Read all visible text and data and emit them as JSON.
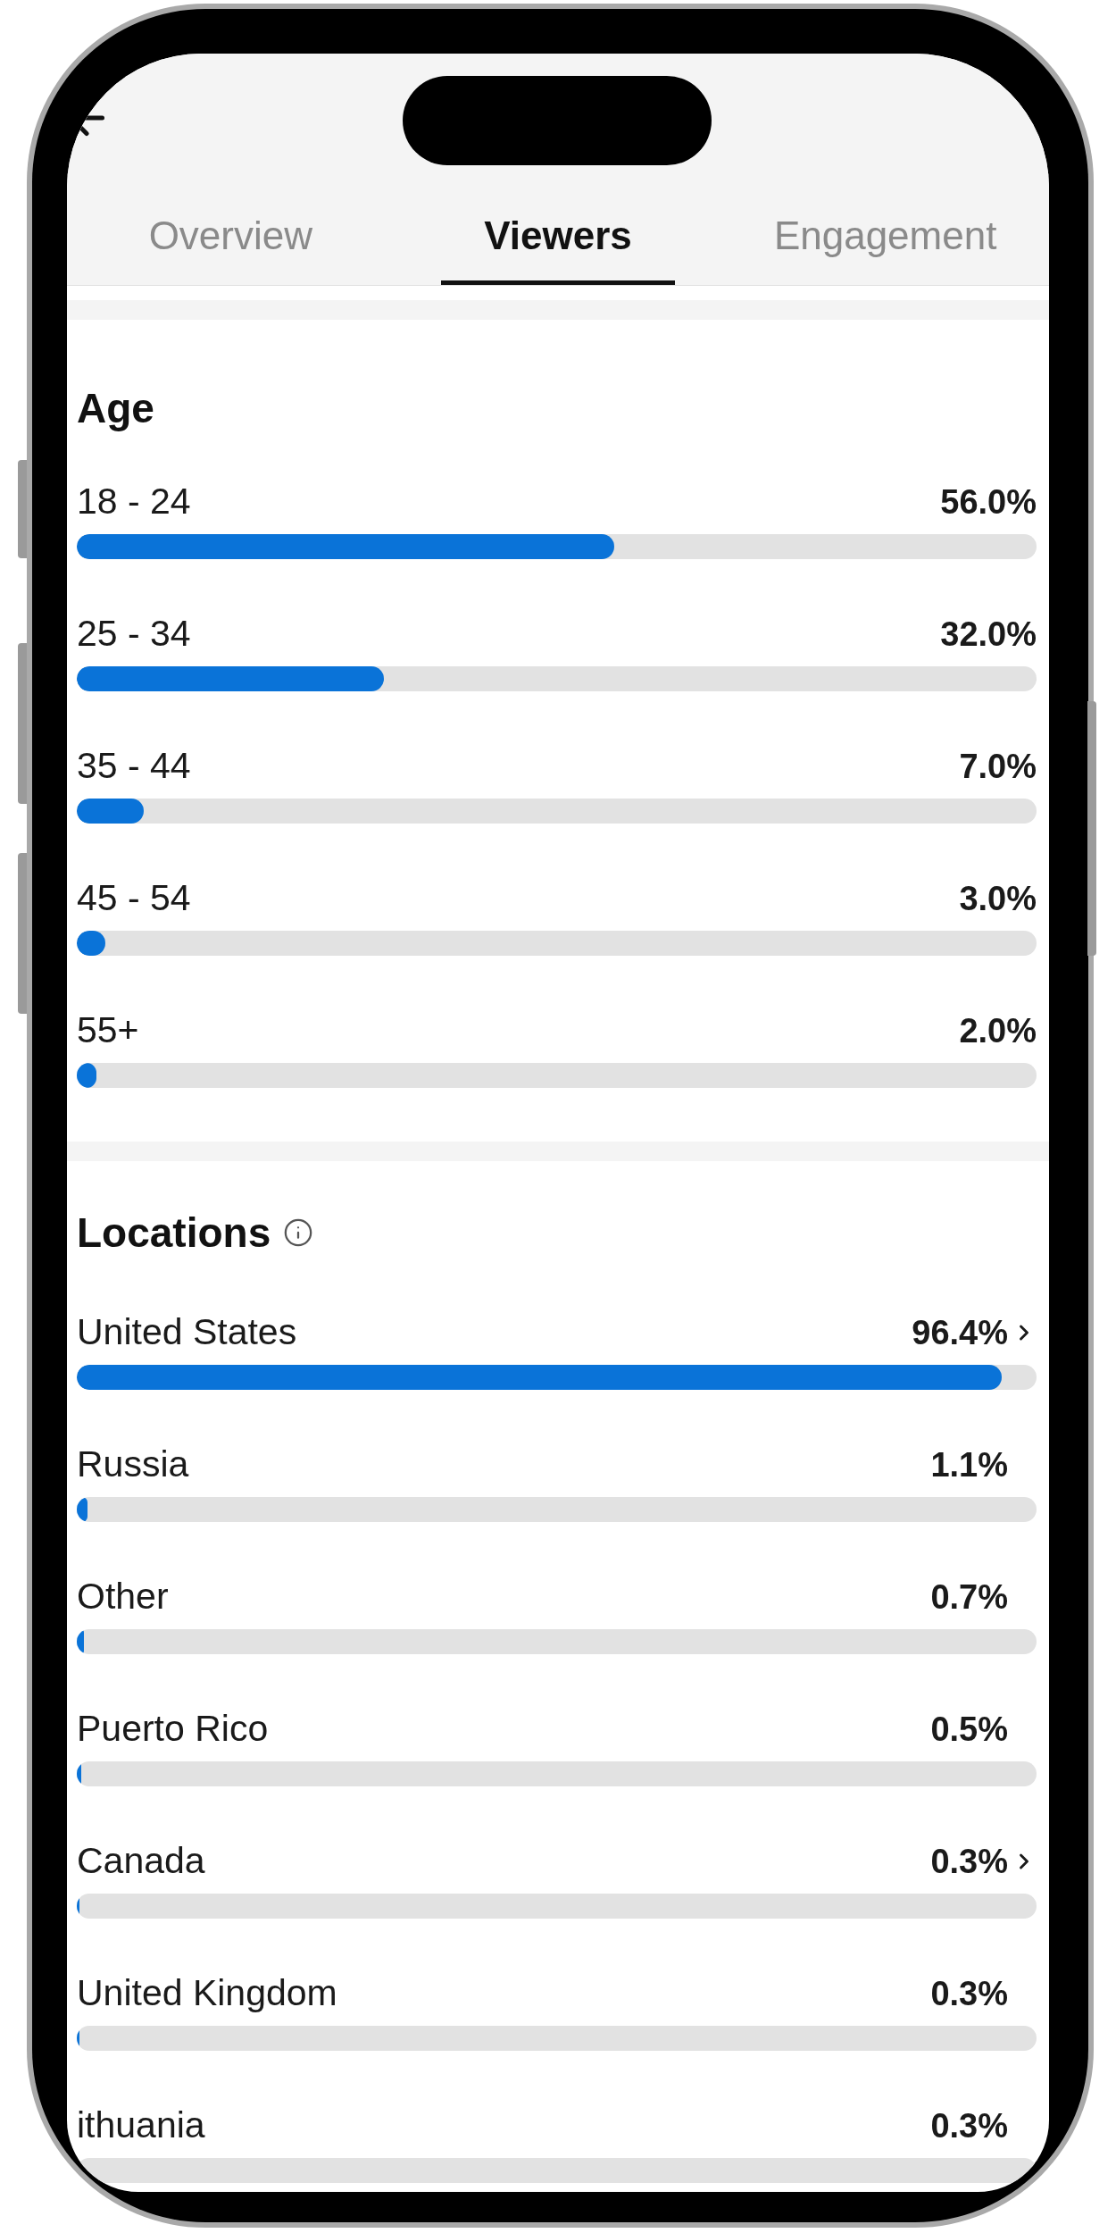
{
  "tabs": [
    {
      "label": "Overview",
      "selected": false
    },
    {
      "label": "Viewers",
      "selected": true
    },
    {
      "label": "Engagement",
      "selected": false
    }
  ],
  "age": {
    "title": "Age",
    "rows": [
      {
        "label": "18 - 24",
        "value": "56.0%",
        "level": 0.56
      },
      {
        "label": "25 - 34",
        "value": "32.0%",
        "level": 0.32
      },
      {
        "label": "35 - 44",
        "value": "7.0%",
        "level": 0.07
      },
      {
        "label": "45 - 54",
        "value": "3.0%",
        "level": 0.03
      },
      {
        "label": "55+",
        "value": "2.0%",
        "level": 0.02
      }
    ]
  },
  "locations": {
    "title": "Locations",
    "rows": [
      {
        "label": "United States",
        "value": "96.4%",
        "level": 0.964,
        "has_detail": true
      },
      {
        "label": "Russia",
        "value": "1.1%",
        "level": 0.011,
        "has_detail": false
      },
      {
        "label": "Other",
        "value": "0.7%",
        "level": 0.007,
        "has_detail": false
      },
      {
        "label": "Puerto Rico",
        "value": "0.5%",
        "level": 0.005,
        "has_detail": false
      },
      {
        "label": "Canada",
        "value": "0.3%",
        "level": 0.003,
        "has_detail": true
      },
      {
        "label": "United Kingdom",
        "value": "0.3%",
        "level": 0.003,
        "has_detail": false
      },
      {
        "label": "ithuania",
        "value": "0.3%",
        "has_detail": false
      }
    ]
  }
}
